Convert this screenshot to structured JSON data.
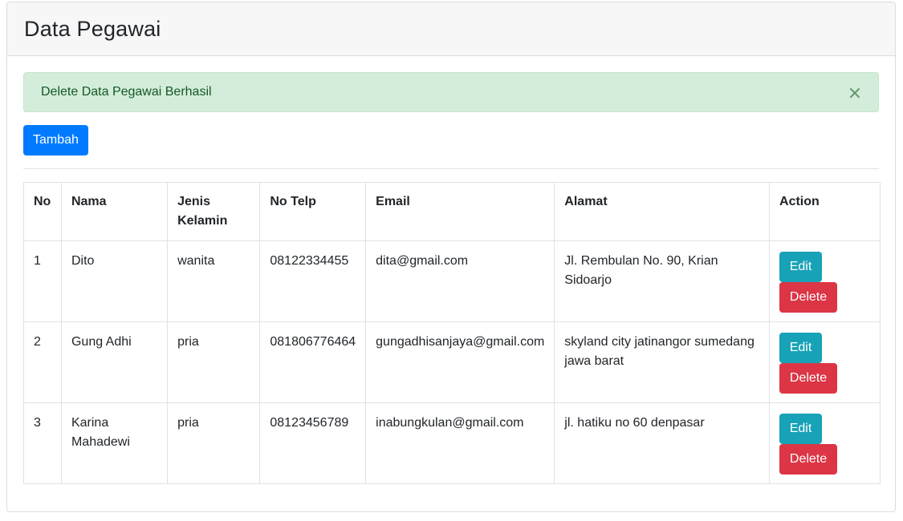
{
  "header": {
    "title": "Data Pegawai"
  },
  "alert": {
    "message": "Delete Data Pegawai Berhasil",
    "close_glyph": "×"
  },
  "toolbar": {
    "add_label": "Tambah"
  },
  "table": {
    "columns": [
      "No",
      "Nama",
      "Jenis Kelamin",
      "No Telp",
      "Email",
      "Alamat",
      "Action"
    ],
    "rows": [
      {
        "no": "1",
        "nama": "Dito",
        "jenis_kelamin": "wanita",
        "no_telp": "08122334455",
        "email": "dita@gmail.com",
        "alamat": "Jl. Rembulan No. 90, Krian Sidoarjo"
      },
      {
        "no": "2",
        "nama": "Gung Adhi",
        "jenis_kelamin": "pria",
        "no_telp": "081806776464",
        "email": "gungadhisanjaya@gmail.com",
        "alamat": "skyland city jatinangor sumedang jawa barat"
      },
      {
        "no": "3",
        "nama": "Karina Mahadewi",
        "jenis_kelamin": "pria",
        "no_telp": "08123456789",
        "email": "inabungkulan@gmail.com",
        "alamat": "jl. hatiku no 60 denpasar"
      }
    ],
    "edit_label": "Edit",
    "delete_label": "Delete"
  },
  "colors": {
    "primary": "#007bff",
    "info": "#17a2b8",
    "danger": "#dc3545",
    "success_bg": "#d4edda",
    "success_text": "#155724"
  }
}
